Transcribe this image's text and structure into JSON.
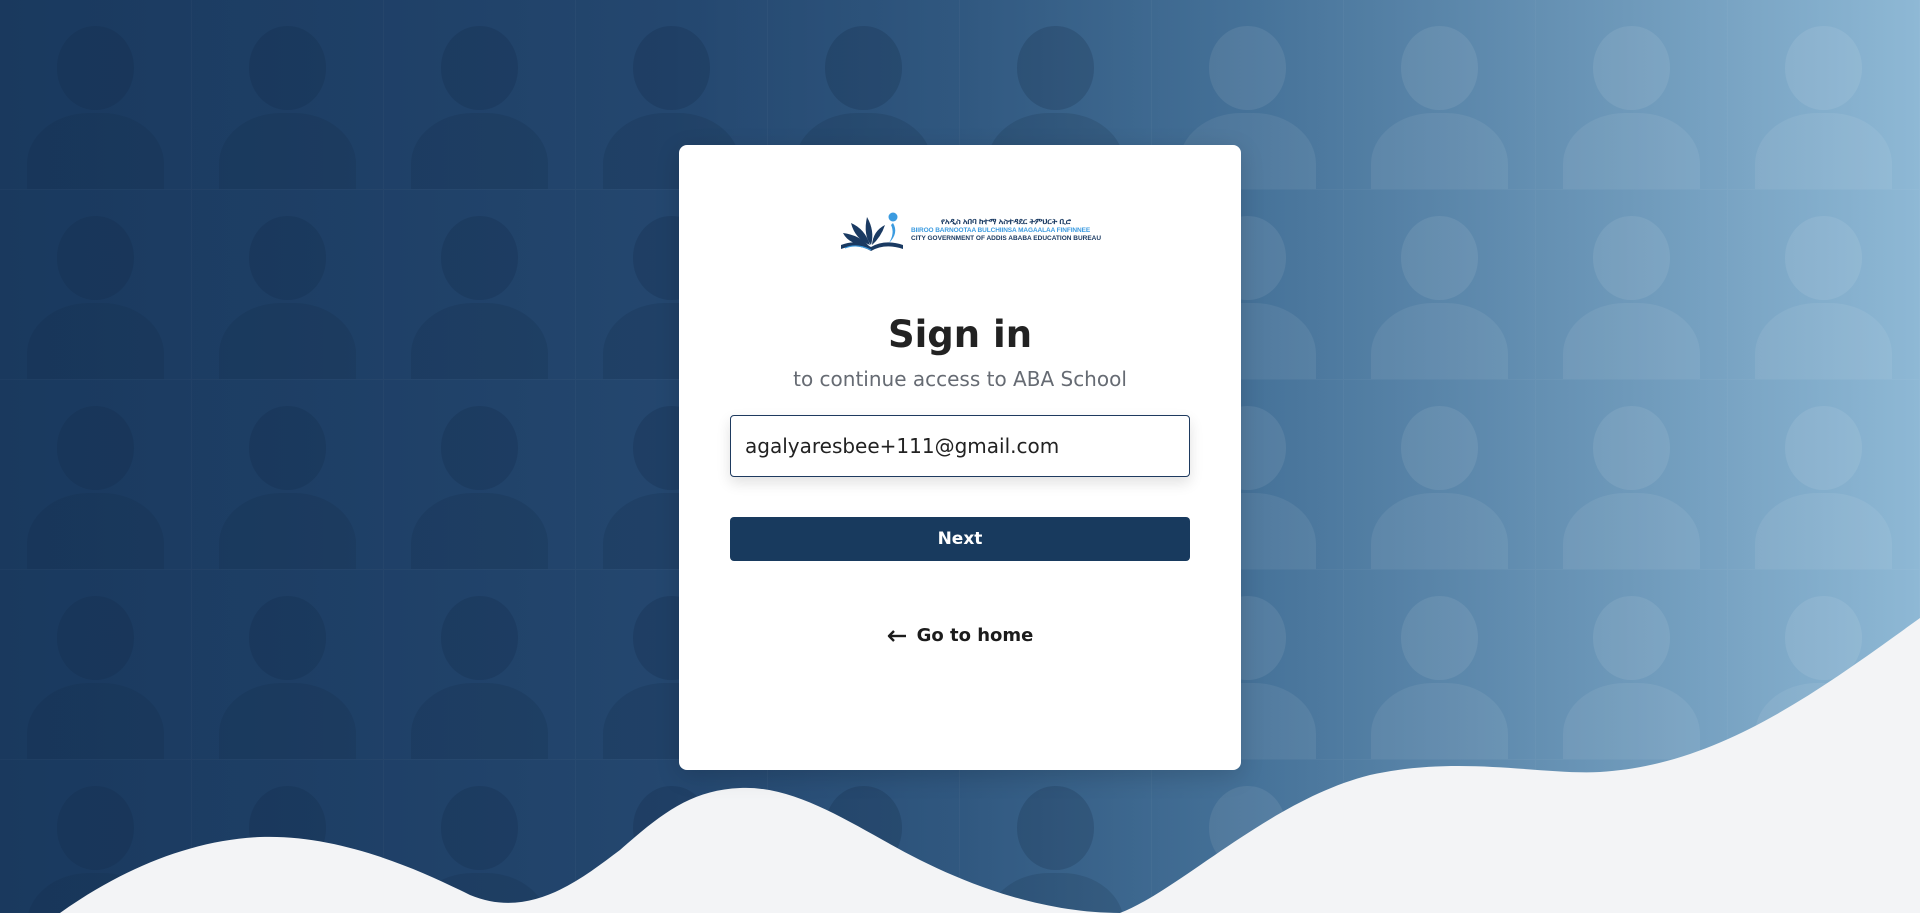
{
  "logo": {
    "line1": "የአዲስ አበባ ከተማ አስተዳደር ትምህርት ቢሮ",
    "line2": "BIIROO BARNOOTAA BULCHIINSA MAGAALAA FINFINNEE",
    "line3": "CITY GOVERNMENT OF ADDIS ABABA  EDUCATION  BUREAU",
    "colors": {
      "primary": "#1a3a62",
      "accent": "#3b9be0"
    }
  },
  "signin": {
    "title": "Sign in",
    "subtitle": "to continue access to ABA School",
    "email_value": "agalyaresbee+111@gmail.com",
    "next_label": "Next",
    "home_label": "Go to home",
    "home_icon": "arrow-left-icon"
  },
  "theme": {
    "button_bg": "#183a5e",
    "wave_fill": "#f3f4f6"
  }
}
